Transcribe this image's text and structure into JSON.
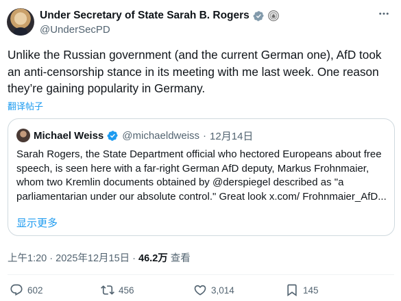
{
  "author": {
    "display_name": "Under Secretary of State Sarah B. Rogers",
    "handle": "@UnderSecPD"
  },
  "post": {
    "text": "Unlike the Russian government (and the current German one), AfD took an anti-censorship stance in its meeting with me last week.  One reason they’re gaining popularity in Germany.",
    "translate_label": "翻译帖子"
  },
  "quoted": {
    "display_name": "Michael Weiss",
    "handle": "@michaeldweiss",
    "separator": "·",
    "date": "12月14日",
    "text": "Sarah Rogers, the State Department official who hectored Europeans about free speech, is seen here with a far-right German AfD deputy, Markus Frohnmaier, whom two Kremlin documents obtained by @derspiegel described as \"a parliamentarian under our absolute control.\" Great look x.com/ Frohnmaier_AfD...",
    "show_more": "显示更多"
  },
  "meta": {
    "time": "上午1:20",
    "separator1": " · ",
    "date": "2025年12月15日",
    "separator2": " · ",
    "views_count": "46.2万",
    "views_label": " 查看"
  },
  "actions": {
    "replies": "602",
    "reposts": "456",
    "likes": "3,014",
    "bookmarks": "145"
  },
  "colors": {
    "accent": "#1d9bf0",
    "secondary_text": "#536471",
    "primary_text": "#0f1419",
    "border": "#cfd9de"
  },
  "icons": [
    "verified-badge-icon",
    "government-badge-icon",
    "more-icon",
    "reply-icon",
    "repost-icon",
    "like-icon",
    "bookmark-icon"
  ]
}
